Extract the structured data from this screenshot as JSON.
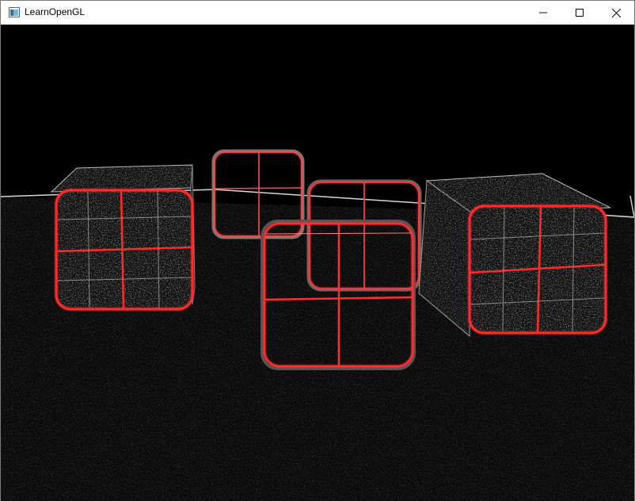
{
  "window": {
    "title": "LearnOpenGL",
    "app_icon": "opengl-app-icon",
    "controls": {
      "minimize_icon": "minimize-icon",
      "maximize_icon": "maximize-icon",
      "close_icon": "close-icon"
    }
  },
  "scene": {
    "description_colors": {
      "background": "#000000",
      "edge_highlight": "#ff2020",
      "edge_white": "#e8e8e8"
    },
    "objects": [
      {
        "name": "left-cube"
      },
      {
        "name": "back-glass-window"
      },
      {
        "name": "middle-glass-window"
      },
      {
        "name": "front-glass-window"
      },
      {
        "name": "right-cube"
      }
    ]
  }
}
